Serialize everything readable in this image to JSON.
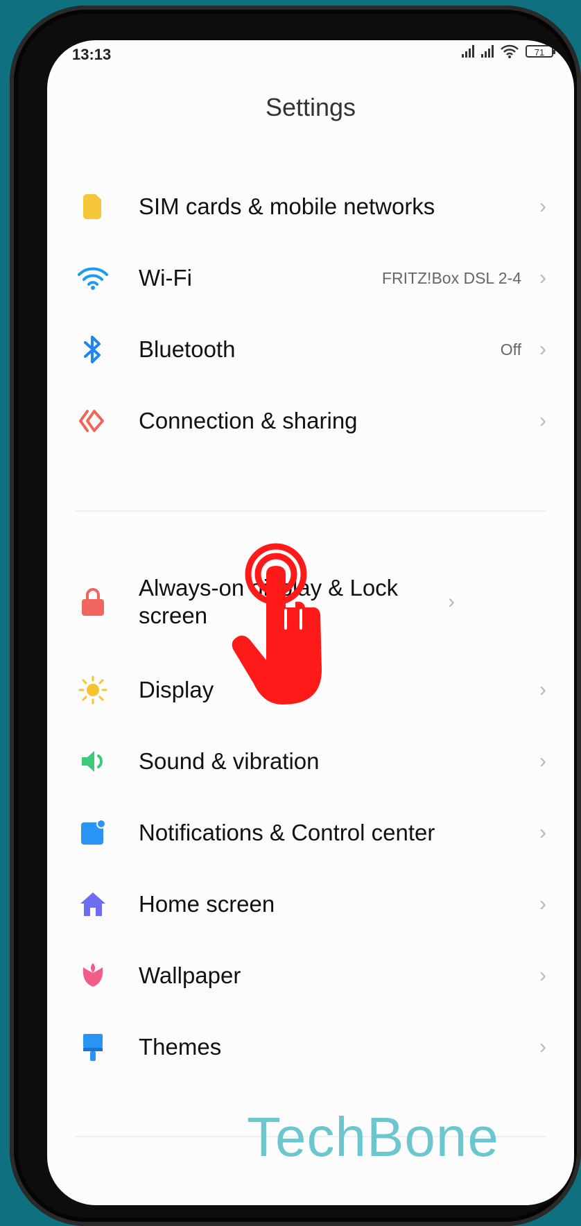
{
  "status": {
    "time": "13:13",
    "battery": "71"
  },
  "page": {
    "title": "Settings"
  },
  "items": [
    {
      "label": "SIM cards & mobile networks",
      "value": "",
      "icon": "sim-card-icon"
    },
    {
      "label": "Wi-Fi",
      "value": "FRITZ!Box DSL 2-4",
      "icon": "wifi-icon"
    },
    {
      "label": "Bluetooth",
      "value": "Off",
      "icon": "bluetooth-icon"
    },
    {
      "label": "Connection & sharing",
      "value": "",
      "icon": "connection-sharing-icon"
    },
    {
      "label": "Always-on display & Lock screen",
      "value": "",
      "icon": "lock-icon"
    },
    {
      "label": "Display",
      "value": "",
      "icon": "sun-icon"
    },
    {
      "label": "Sound & vibration",
      "value": "",
      "icon": "speaker-icon"
    },
    {
      "label": "Notifications & Control center",
      "value": "",
      "icon": "notification-icon"
    },
    {
      "label": "Home screen",
      "value": "",
      "icon": "home-icon"
    },
    {
      "label": "Wallpaper",
      "value": "",
      "icon": "tulip-icon"
    },
    {
      "label": "Themes",
      "value": "",
      "icon": "brush-icon"
    }
  ],
  "chevron": "›",
  "watermark": "TechBone",
  "colors": {
    "background": "#0f7180",
    "watermark": "#6cc6cf",
    "hand": "#ff1a1a"
  }
}
